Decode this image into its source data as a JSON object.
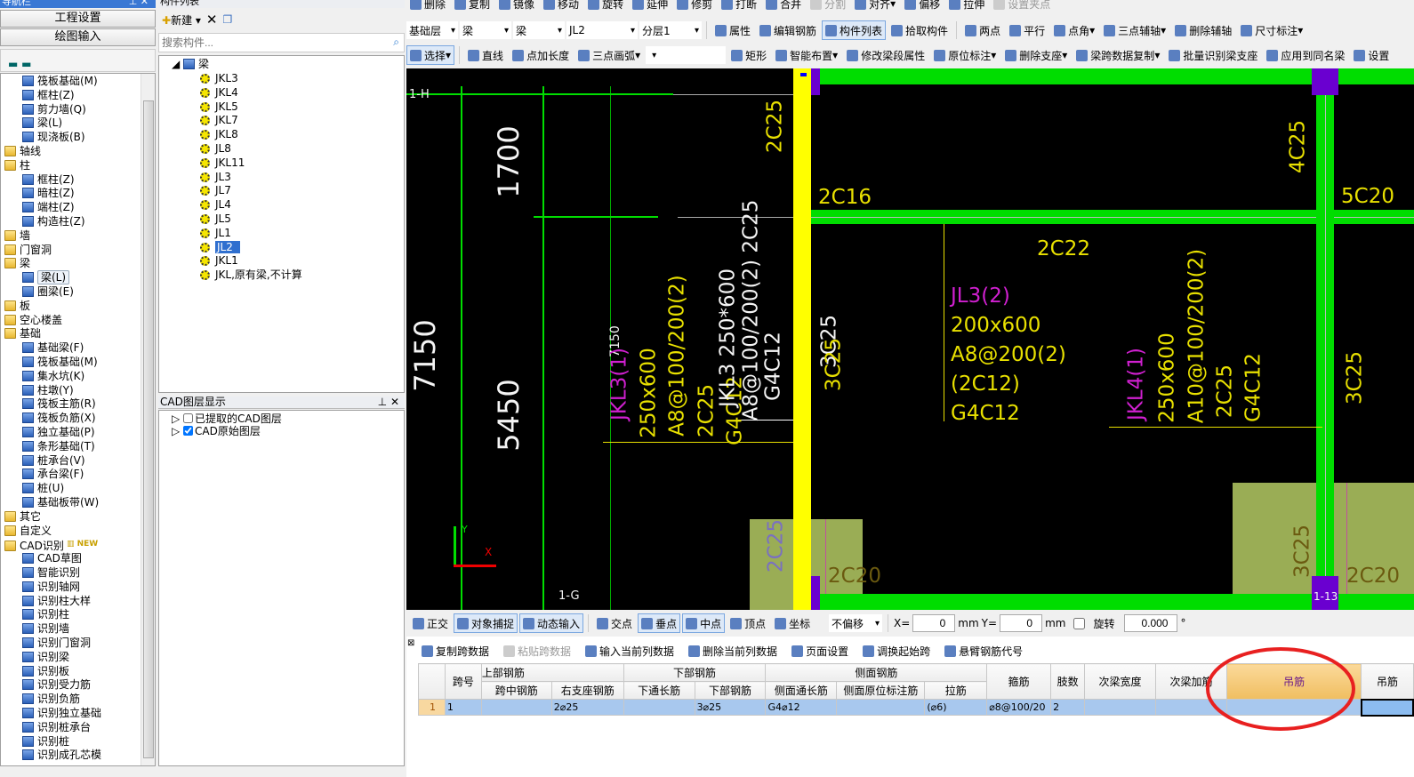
{
  "nav": {
    "title": "导航栏",
    "buttons": [
      "工程设置",
      "绘图输入"
    ],
    "tree": [
      {
        "label": "筏板基础(M)",
        "level": 2
      },
      {
        "label": "框柱(Z)",
        "level": 2
      },
      {
        "label": "剪力墙(Q)",
        "level": 2
      },
      {
        "label": "梁(L)",
        "level": 2
      },
      {
        "label": "现浇板(B)",
        "level": 2
      },
      {
        "label": "轴线",
        "level": 1
      },
      {
        "label": "柱",
        "level": 1
      },
      {
        "label": "框柱(Z)",
        "level": 2
      },
      {
        "label": "暗柱(Z)",
        "level": 2
      },
      {
        "label": "端柱(Z)",
        "level": 2
      },
      {
        "label": "构造柱(Z)",
        "level": 2
      },
      {
        "label": "墙",
        "level": 1
      },
      {
        "label": "门窗洞",
        "level": 1
      },
      {
        "label": "梁",
        "level": 1
      },
      {
        "label": "梁(L)",
        "level": 2,
        "selected": true
      },
      {
        "label": "圈梁(E)",
        "level": 2
      },
      {
        "label": "板",
        "level": 1
      },
      {
        "label": "空心楼盖",
        "level": 1
      },
      {
        "label": "基础",
        "level": 1
      },
      {
        "label": "基础梁(F)",
        "level": 2
      },
      {
        "label": "筏板基础(M)",
        "level": 2
      },
      {
        "label": "集水坑(K)",
        "level": 2
      },
      {
        "label": "柱墩(Y)",
        "level": 2
      },
      {
        "label": "筏板主筋(R)",
        "level": 2
      },
      {
        "label": "筏板负筋(X)",
        "level": 2
      },
      {
        "label": "独立基础(P)",
        "level": 2
      },
      {
        "label": "条形基础(T)",
        "level": 2
      },
      {
        "label": "桩承台(V)",
        "level": 2
      },
      {
        "label": "承台梁(F)",
        "level": 2
      },
      {
        "label": "桩(U)",
        "level": 2
      },
      {
        "label": "基础板带(W)",
        "level": 2
      },
      {
        "label": "其它",
        "level": 1
      },
      {
        "label": "自定义",
        "level": 1
      },
      {
        "label": "CAD识别",
        "level": 1,
        "badge": "NEW"
      },
      {
        "label": "CAD草图",
        "level": 2
      },
      {
        "label": "智能识别",
        "level": 2
      },
      {
        "label": "识别轴网",
        "level": 2
      },
      {
        "label": "识别柱大样",
        "level": 2
      },
      {
        "label": "识别柱",
        "level": 2
      },
      {
        "label": "识别墙",
        "level": 2
      },
      {
        "label": "识别门窗洞",
        "level": 2
      },
      {
        "label": "识别梁",
        "level": 2
      },
      {
        "label": "识别板",
        "level": 2
      },
      {
        "label": "识别受力筋",
        "level": 2
      },
      {
        "label": "识别负筋",
        "level": 2
      },
      {
        "label": "识别独立基础",
        "level": 2
      },
      {
        "label": "识别桩承台",
        "level": 2
      },
      {
        "label": "识别桩",
        "level": 2
      },
      {
        "label": "识别成孔芯模",
        "level": 2
      }
    ]
  },
  "components": {
    "title": "构件列表",
    "new_label": "新建",
    "search_placeholder": "搜索构件...",
    "root": "梁",
    "items": [
      "JKL3",
      "JKL4",
      "JKL5",
      "JKL7",
      "JKL8",
      "JL8",
      "JKL11",
      "JL3",
      "JL7",
      "JL4",
      "JL5",
      "JL1",
      "JL2",
      "JKL1",
      "JKL,原有梁,不计算"
    ],
    "selected": "JL2"
  },
  "cad_layers": {
    "title": "CAD图层显示",
    "items": [
      {
        "label": "已提取的CAD图层",
        "checked": false
      },
      {
        "label": "CAD原始图层",
        "checked": true
      }
    ]
  },
  "toolbar1": [
    {
      "label": "删除"
    },
    {
      "label": "复制"
    },
    {
      "label": "镜像"
    },
    {
      "label": "移动"
    },
    {
      "label": "旋转"
    },
    {
      "label": "延伸"
    },
    {
      "label": "修剪"
    },
    {
      "label": "打断"
    },
    {
      "label": "合并"
    },
    {
      "label": "分割",
      "disabled": true
    },
    {
      "label": "对齐",
      "dropdown": true
    },
    {
      "label": "偏移"
    },
    {
      "label": "拉伸"
    },
    {
      "label": "设置夹点",
      "disabled": true
    }
  ],
  "selectors": [
    "基础层",
    "梁",
    "梁",
    "JL2",
    "分层1"
  ],
  "toolbar2": [
    {
      "label": "属性"
    },
    {
      "label": "编辑钢筋"
    },
    {
      "label": "构件列表",
      "active": true
    },
    {
      "label": "拾取构件"
    },
    {
      "sep": true
    },
    {
      "label": "两点"
    },
    {
      "label": "平行"
    },
    {
      "label": "点角",
      "dropdown": true
    },
    {
      "label": "三点辅轴",
      "dropdown": true
    },
    {
      "label": "删除辅轴"
    },
    {
      "label": "尺寸标注",
      "dropdown": true
    }
  ],
  "toolbar3": [
    {
      "label": "选择",
      "active": true,
      "dropdown": true
    },
    {
      "sep": true
    },
    {
      "label": "直线"
    },
    {
      "label": "点加长度"
    },
    {
      "label": "三点画弧",
      "dropdown": true
    },
    {
      "blank": true
    },
    {
      "label": "矩形"
    },
    {
      "label": "智能布置",
      "dropdown": true
    },
    {
      "label": "修改梁段属性"
    },
    {
      "label": "原位标注",
      "dropdown": true
    },
    {
      "label": "删除支座",
      "dropdown": true
    },
    {
      "label": "梁跨数据复制",
      "dropdown": true
    },
    {
      "label": "批量识别梁支座"
    },
    {
      "label": "应用到同名梁"
    },
    {
      "label": "设置"
    }
  ],
  "snapbar": [
    {
      "label": "正交"
    },
    {
      "label": "对象捕捉",
      "active": true
    },
    {
      "label": "动态输入",
      "active": true
    },
    {
      "sep": true
    },
    {
      "label": "交点"
    },
    {
      "label": "垂点",
      "active": true
    },
    {
      "label": "中点",
      "active": true
    },
    {
      "label": "顶点"
    },
    {
      "label": "坐标"
    }
  ],
  "offset": {
    "mode": "不偏移",
    "x_label": "X=",
    "x": "0",
    "y_label": "Y=",
    "y": "0",
    "unit": "mm",
    "rotate_label": "旋转",
    "rotate": "0.000",
    "deg": "°"
  },
  "databar": [
    {
      "label": "复制跨数据"
    },
    {
      "label": "粘贴跨数据",
      "disabled": true
    },
    {
      "label": "输入当前列数据"
    },
    {
      "label": "删除当前列数据"
    },
    {
      "label": "页面设置"
    },
    {
      "label": "调换起始跨"
    },
    {
      "label": "悬臂钢筋代号"
    }
  ],
  "cad": {
    "dims": [
      "7150",
      "1700",
      "5450",
      "7150"
    ],
    "axes": [
      "1-H",
      "1-G",
      "1-13"
    ],
    "coord": {
      "y": "Y",
      "x": "X"
    },
    "JKL3": [
      "JKL3(1)",
      "250x600",
      "A8@100/200(2)",
      "2C25",
      "G4C12"
    ],
    "jkl3_white": [
      "JKL3 250*600",
      "A8@100/200(2) 2C25",
      "G4C12"
    ],
    "JL3": [
      "JL3(2)",
      "200x600",
      "A8@200(2)",
      "(2C12)",
      "G4C12"
    ],
    "JKL4": [
      "JKL4(1)",
      "250x600",
      "A10@100/200(2)",
      "2C25",
      "G4C12"
    ],
    "rebar": {
      "top_left": "2C25",
      "c16": "2C16",
      "c22": "2C22",
      "c20a": "2C20",
      "c20b": "2C20",
      "c5": "5C20",
      "c4": "4C25",
      "c3a": "3C25",
      "c3b": "3C25",
      "c3c": "3C25",
      "c3d": "3C25",
      "olive25": "2C25"
    },
    "colors": {
      "beam_green": "#00dd00",
      "beam_selected": "#ffff00",
      "column": "#6a00d0",
      "foundation": "#9aad55",
      "label_magenta": "#d020d0",
      "label_yellow": "#e8e000"
    }
  },
  "table": {
    "groups": [
      "上部钢筋",
      "下部钢筋",
      "侧面钢筋"
    ],
    "span_label": "跨号",
    "sub": [
      "跨中钢筋",
      "右支座钢筋",
      "下通长筋",
      "下部钢筋",
      "侧面通长筋",
      "侧面原位标注筋",
      "拉筋"
    ],
    "tail": [
      "箍筋",
      "肢数",
      "次梁宽度",
      "次梁加筋",
      "吊筋",
      "吊筋"
    ],
    "rows": [
      {
        "idx": "1",
        "span": "1",
        "cells": [
          "",
          "2⌀25",
          "",
          "3⌀25",
          "G4⌀12",
          "",
          "(⌀6)",
          "⌀8@100/20",
          "2",
          "",
          "",
          "",
          ""
        ]
      }
    ],
    "highlight_color": "#f0be60"
  },
  "annotation_color": "#e82020"
}
